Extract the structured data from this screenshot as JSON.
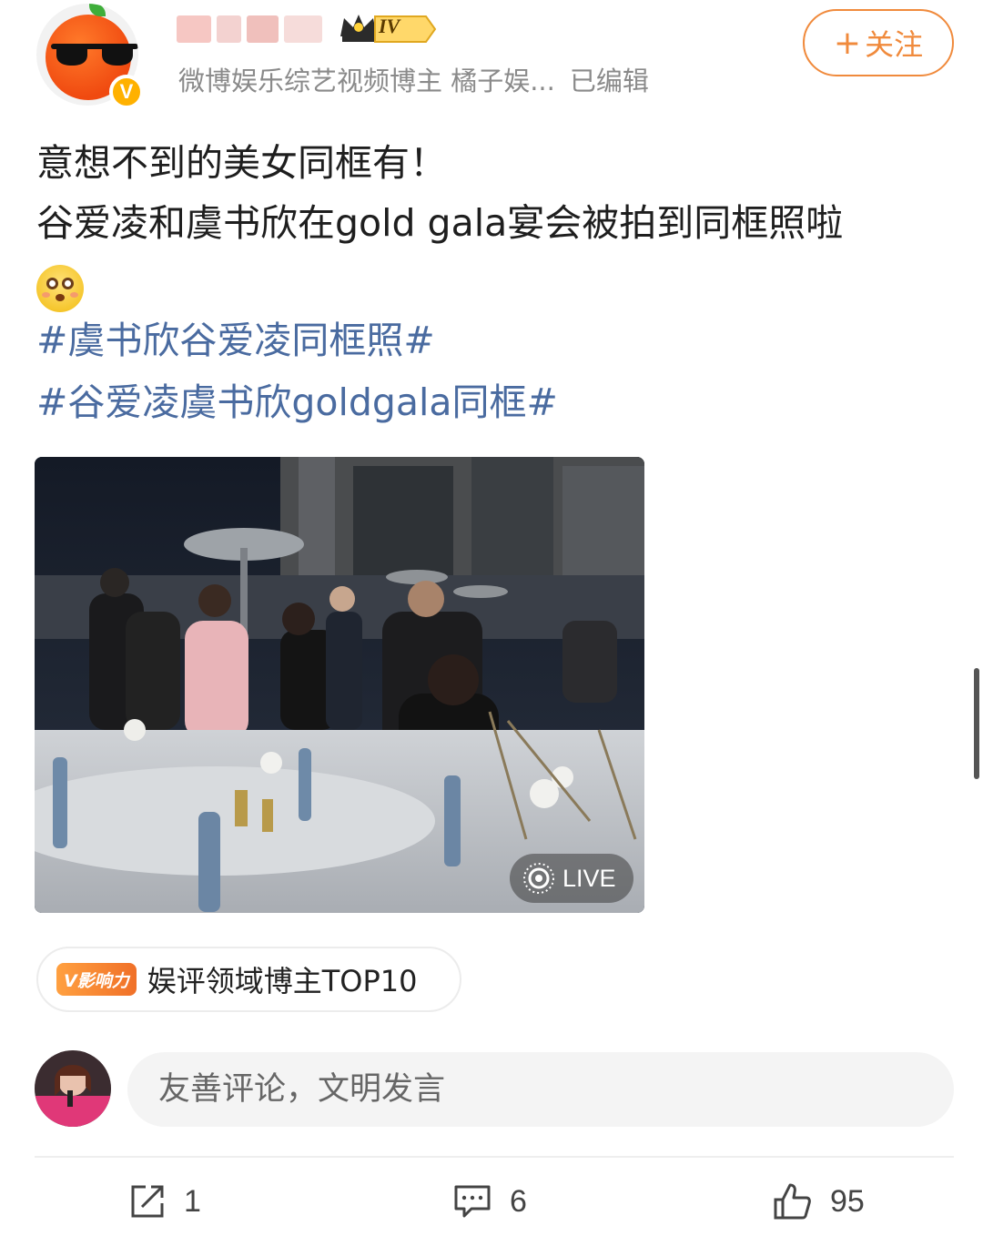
{
  "author": {
    "level": "IV",
    "subtitle": "微博娱乐综艺视频博主 橘子娱...",
    "edited": "已编辑"
  },
  "follow_button": {
    "label": "关注",
    "plus": "+"
  },
  "post": {
    "line1": "意想不到的美女同框有！",
    "line2": "谷爱凌和虞书欣在gold gala宴会被拍到同框照啦",
    "hashtags": [
      "#虞书欣谷爱凌同框照#",
      "#谷爱凌虞书欣goldgala同框#"
    ]
  },
  "photo": {
    "live_label": "LIVE"
  },
  "influence": {
    "badge": "V影响力",
    "text": "娱评领域博主TOP10"
  },
  "comment": {
    "placeholder": "友善评论，文明发言"
  },
  "actions": {
    "share_count": "1",
    "comment_count": "6",
    "like_count": "95"
  },
  "colors": {
    "accent": "#f08a3c",
    "hashtag": "#4a6ba0"
  }
}
